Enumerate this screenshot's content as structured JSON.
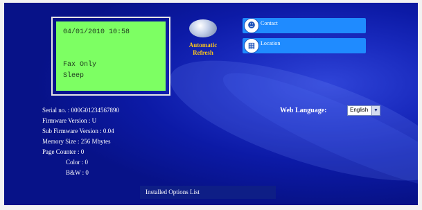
{
  "lcd": {
    "datetime": "04/01/2010 10:58",
    "line1": "Fax Only",
    "line2": "Sleep"
  },
  "refresh": {
    "label_line1": "Automatic",
    "label_line2": "Refresh",
    "icon": "refresh-icon"
  },
  "buttons": [
    {
      "label": "Contact",
      "icon": "contact-person-icon"
    },
    {
      "label": "Location",
      "icon": "location-building-icon"
    }
  ],
  "info": {
    "serial": "Serial no. : 000G01234567890",
    "firmware": "Firmware Version : U",
    "sub_firmware": "Sub Firmware Version : 0.04",
    "memory": "Memory Size : 256 Mbytes",
    "page_counter": "Page Counter : 0",
    "color": "Color : 0",
    "bw": "B&W : 0"
  },
  "language": {
    "label": "Web Language:",
    "selected": "English"
  },
  "options": {
    "label": "Installed Options List"
  },
  "colors": {
    "background": "#0c1aa6",
    "lcd": "#7dff63",
    "button": "#1f8bff",
    "refresh_label": "#f7c21e"
  }
}
